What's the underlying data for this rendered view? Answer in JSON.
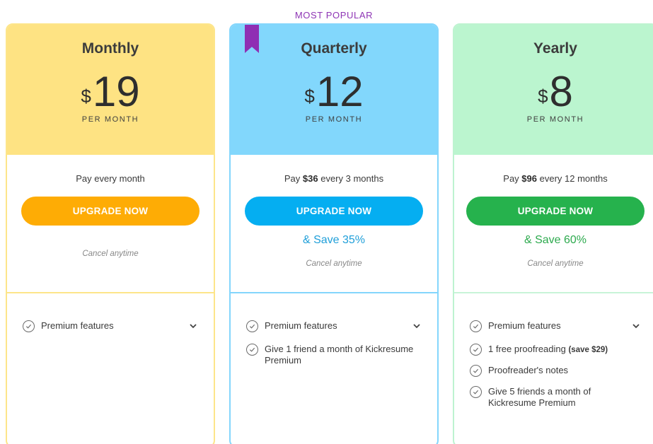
{
  "most_popular_label": "MOST POPULAR",
  "colors": {
    "monthly_head": "#fee383",
    "quarterly_head": "#82d7fc",
    "yearly_head": "#bbf5cf",
    "monthly_button": "#feac05",
    "quarterly_button": "#05aef1",
    "yearly_button": "#26b24d",
    "ribbon": "#8f2fb3"
  },
  "plans": {
    "monthly": {
      "name": "Monthly",
      "currency": "$",
      "amount": "19",
      "per": "PER MONTH",
      "pay_prefix": "Pay every month",
      "pay_amount": "",
      "pay_suffix": "",
      "button": "UPGRADE NOW",
      "cancel": "Cancel anytime",
      "features": [
        {
          "text": "Premium features",
          "icon": "check-circle-icon"
        }
      ]
    },
    "quarterly": {
      "name": "Quarterly",
      "currency": "$",
      "amount": "12",
      "per": "PER MONTH",
      "pay_prefix": "Pay ",
      "pay_amount": "$36",
      "pay_suffix": " every 3 months",
      "button": "UPGRADE NOW",
      "save": "& Save 35%",
      "cancel": "Cancel anytime",
      "features": [
        {
          "text": "Premium features",
          "icon": "check-circle-icon"
        },
        {
          "text": "Give 1 friend a month of Kickresume Premium",
          "icon": "check-circle-icon"
        }
      ]
    },
    "yearly": {
      "name": "Yearly",
      "currency": "$",
      "amount": "8",
      "per": "PER MONTH",
      "pay_prefix": "Pay ",
      "pay_amount": "$96",
      "pay_suffix": " every 12 months",
      "button": "UPGRADE NOW",
      "save": "& Save 60%",
      "cancel": "Cancel anytime",
      "features": [
        {
          "text": "Premium features",
          "icon": "check-circle-icon"
        },
        {
          "text": "1 free proofreading ",
          "bold": "(save $29)",
          "icon": "check-circle-icon"
        },
        {
          "text": "Proofreader's notes",
          "icon": "check-circle-icon"
        },
        {
          "text": "Give 5 friends a month of Kickresume Premium",
          "icon": "check-circle-icon"
        }
      ]
    }
  }
}
